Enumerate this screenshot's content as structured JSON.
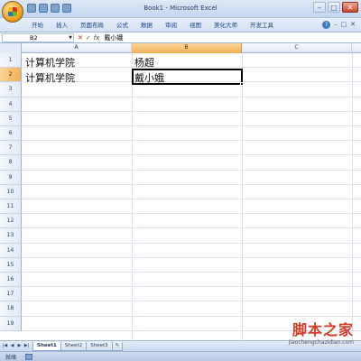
{
  "window": {
    "title": "Book1 - Microsoft Excel",
    "controls": {
      "minimize": "–",
      "maximize": "□",
      "close": "✕"
    }
  },
  "ribbon": {
    "tabs": [
      "开始",
      "插入",
      "页面布局",
      "公式",
      "数据",
      "审阅",
      "视图",
      "美化大师",
      "开发工具"
    ],
    "help": "?",
    "extra": [
      "–",
      "□",
      "✕"
    ]
  },
  "formula_bar": {
    "name_box": "B2",
    "cancel": "✕",
    "enter": "✓",
    "fx": "fx",
    "content": "戴小娥"
  },
  "grid": {
    "columns": [
      "A",
      "B",
      "C"
    ],
    "selected_column": "B",
    "rows": [
      "1",
      "2",
      "3",
      "4",
      "5",
      "6",
      "7",
      "8",
      "9",
      "10",
      "11",
      "12",
      "13",
      "14",
      "15",
      "16",
      "17",
      "18",
      "19"
    ],
    "selected_row": "2",
    "cells": {
      "A1": "计算机学院",
      "B1": "杨超",
      "A2": "计算机学院",
      "B2": "戴小娥"
    },
    "active_cell": "B2"
  },
  "sheet_tabs": {
    "nav": [
      "|◀",
      "◀",
      "▶",
      "▶|"
    ],
    "tabs": [
      "Sheet1",
      "Sheet2",
      "Sheet3"
    ],
    "active": "Sheet1"
  },
  "status_bar": {
    "mode": "就绪"
  },
  "watermark": {
    "main": "脚本之家",
    "sub": "jiaochengchazidian.com"
  }
}
